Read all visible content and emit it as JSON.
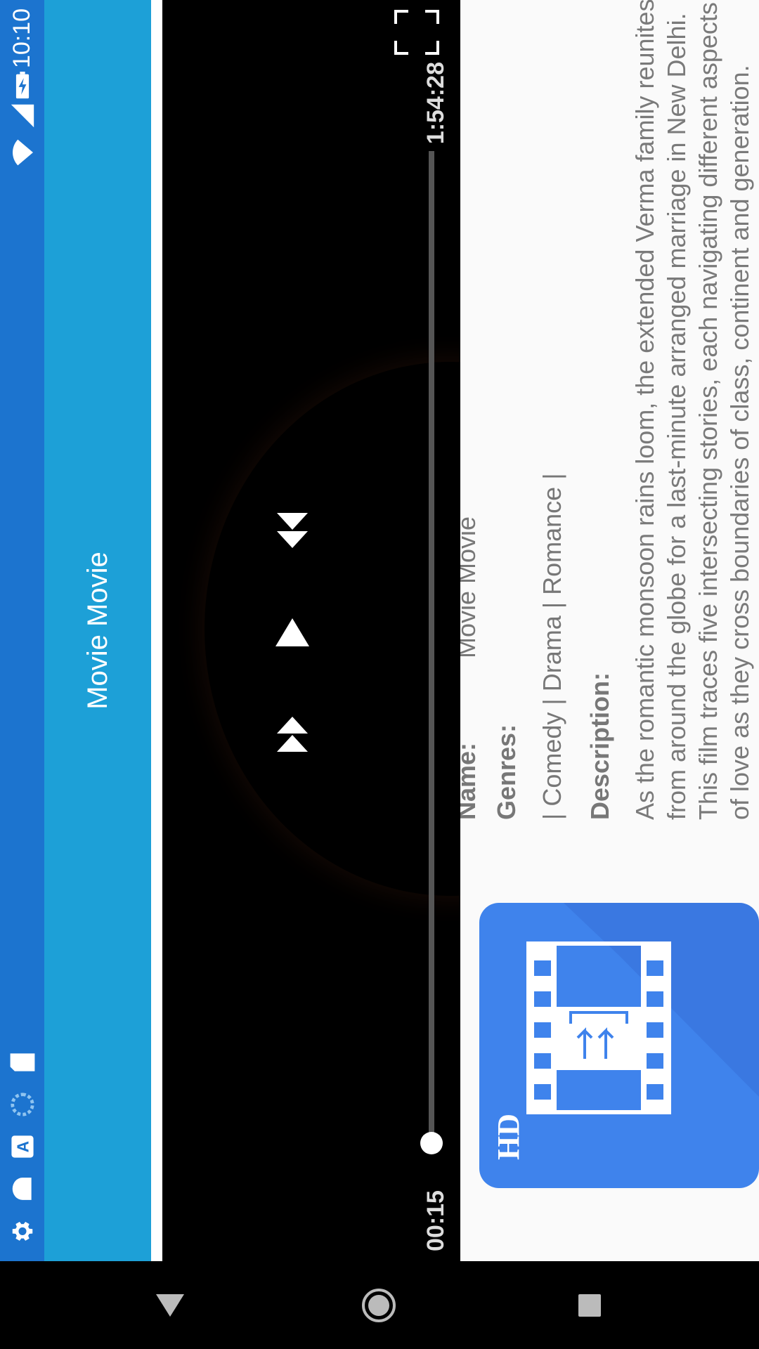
{
  "status_bar": {
    "time": "10:10",
    "icons": [
      "wifi-icon",
      "signal-icon",
      "battery-charging-icon",
      "settings-icon",
      "notification-icon",
      "a-icon",
      "sync-icon",
      "sd-card-icon"
    ]
  },
  "app_bar": {
    "title": "Movie Movie"
  },
  "player": {
    "current_time": "00:15",
    "total_time": "1:54:28",
    "progress": 0.002,
    "controls": [
      "rewind-icon",
      "play-icon",
      "fast-forward-icon",
      "fullscreen-icon"
    ]
  },
  "details": {
    "name_label": "Name:",
    "name_value": "Movie Movie",
    "genres_label": "Genres:",
    "genres_value": "| Comedy | Drama | Romance |",
    "description_label": "Description:",
    "description": "As the romantic monsoon rains loom, the extended Verma family reunites from around the globe for a last-minute arranged marriage in New Delhi. This film traces five intersecting stories, each navigating different aspects of love as they cross boundaries of class, continent and generation."
  },
  "poster": {
    "badge": "HD"
  },
  "nav_bar": {
    "buttons": [
      "back-icon",
      "home-icon",
      "recents-icon"
    ]
  },
  "colors": {
    "status_bar": "#1c74cf",
    "app_bar": "#1da0d7",
    "poster_bg": "#3f83ec"
  }
}
